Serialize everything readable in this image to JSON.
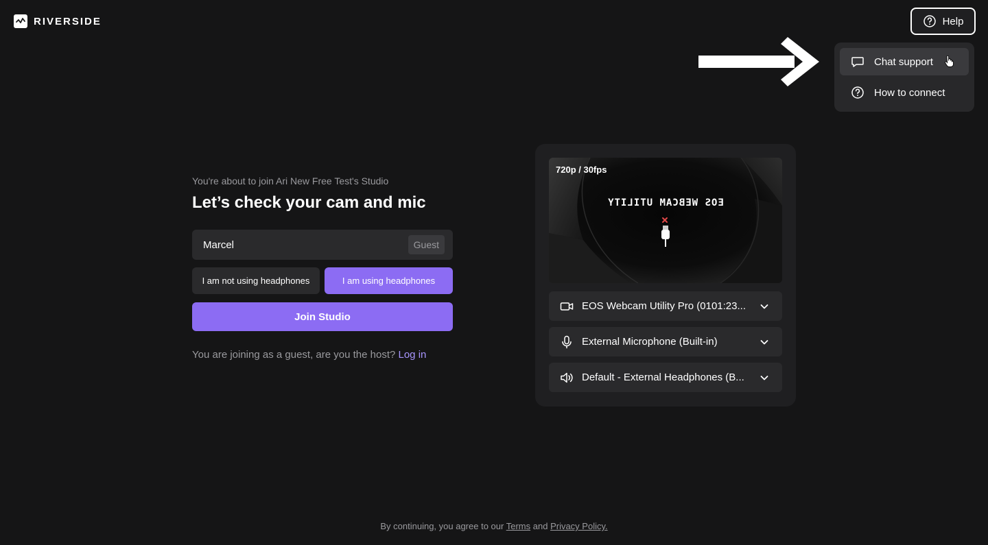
{
  "app": {
    "logo_text": "RIVERSIDE"
  },
  "header": {
    "help_label": "Help"
  },
  "help_menu": {
    "items": [
      {
        "label": "Chat support",
        "icon": "chat-bubble-icon"
      },
      {
        "label": "How to connect",
        "icon": "question-circle-icon"
      }
    ]
  },
  "join": {
    "intro": "You're about to join Ari New Free Test's Studio",
    "title": "Let’s check your cam and mic",
    "name_value": "Marcel",
    "role_badge": "Guest",
    "headphones_off_label": "I am not using headphones",
    "headphones_on_label": "I am using headphones",
    "join_button_label": "Join Studio",
    "guest_note": "You are joining as a guest, are you the host?",
    "login_label": "Log in"
  },
  "devices": {
    "resolution": "720p / 30fps",
    "preview_camera_text": "EOS WEBCAM UTILITY",
    "camera_label": "EOS Webcam Utility Pro (0101:23...",
    "microphone_label": "External Microphone (Built-in)",
    "speaker_label": "Default - External Headphones (B..."
  },
  "footer": {
    "prefix": "By continuing, you agree to our",
    "terms_label": "Terms",
    "and_label": "and",
    "privacy_label": "Privacy Policy."
  },
  "colors": {
    "background": "#151516",
    "accent": "#8c6cf3",
    "link": "#a895ff",
    "surface": "#2a2a2c"
  }
}
